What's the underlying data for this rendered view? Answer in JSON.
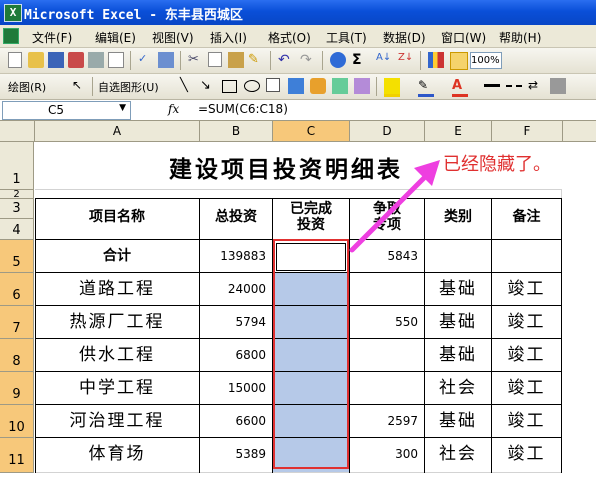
{
  "window": {
    "title": "Microsoft Excel - 东丰县西城区"
  },
  "menu": [
    "文件(F)",
    "编辑(E)",
    "视图(V)",
    "插入(I)",
    "格式(O)",
    "工具(T)",
    "数据(D)",
    "窗口(W)",
    "帮助(H)"
  ],
  "toolbar": {
    "zoom": "100%",
    "draw_label": "绘图(R)",
    "autoshape_label": "自选图形(U)"
  },
  "formula_bar": {
    "name_box": "C5",
    "fx": "fx",
    "formula": "=SUM(C6:C18)"
  },
  "columns": [
    "A",
    "B",
    "C",
    "D",
    "E",
    "F"
  ],
  "rows": [
    "1",
    "2",
    "3",
    "4",
    "5",
    "6",
    "7",
    "8",
    "9",
    "10",
    "11"
  ],
  "sheet": {
    "title": "建设项目投资明细表",
    "annotation": "已经隐藏了。",
    "headers": {
      "a": "项目名称",
      "b": "总投资",
      "c": "已完成\n投资",
      "d": "争取\n专项",
      "e": "类别",
      "f": "备注"
    },
    "data": [
      {
        "a": "合计",
        "b": "139883",
        "c": "",
        "d": "5843",
        "e": "",
        "f": ""
      },
      {
        "a": "道路工程",
        "b": "24000",
        "c": "",
        "d": "",
        "e": "基础",
        "f": "竣工"
      },
      {
        "a": "热源厂工程",
        "b": "5794",
        "c": "",
        "d": "550",
        "e": "基础",
        "f": "竣工"
      },
      {
        "a": "供水工程",
        "b": "6800",
        "c": "",
        "d": "",
        "e": "基础",
        "f": "竣工"
      },
      {
        "a": "中学工程",
        "b": "15000",
        "c": "",
        "d": "",
        "e": "社会",
        "f": "竣工"
      },
      {
        "a": "河治理工程",
        "b": "6600",
        "c": "",
        "d": "2597",
        "e": "基础",
        "f": "竣工"
      },
      {
        "a": "体育场",
        "b": "5389",
        "c": "",
        "d": "300",
        "e": "社会",
        "f": "竣工"
      }
    ]
  },
  "colors": {
    "title_bar": "#0a4fd8",
    "selection": "#b6c9e8",
    "highlight_border": "#e03030",
    "arrow": "#ee3fe0",
    "annotation": "#e03030"
  }
}
